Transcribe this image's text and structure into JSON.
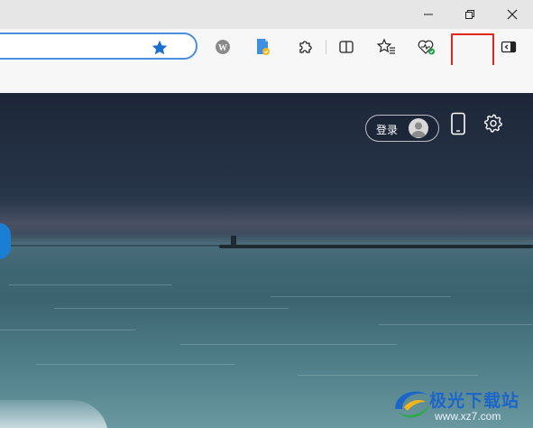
{
  "window": {
    "minimize_icon": "minimize-icon",
    "restore_icon": "restore-icon",
    "close_icon": "close-icon"
  },
  "toolbar": {
    "address_value": "",
    "favorite_icon": "star-filled-icon",
    "icons": [
      "wikipedia-extension-icon",
      "bookmark-extension-icon",
      "extensions-puzzle-icon",
      "split-screen-icon",
      "favorites-icon",
      "browser-essentials-icon",
      "more-options-icon",
      "sidebar-toggle-icon"
    ],
    "more_label": "···",
    "highlight_color": "#e0261b",
    "accent_color": "#1a6fd1"
  },
  "newtab": {
    "login_label": "登录",
    "phone_icon": "phone-icon",
    "settings_icon": "gear-icon"
  },
  "watermark": {
    "title": "极光下载站",
    "url": "www.xz7.com"
  }
}
